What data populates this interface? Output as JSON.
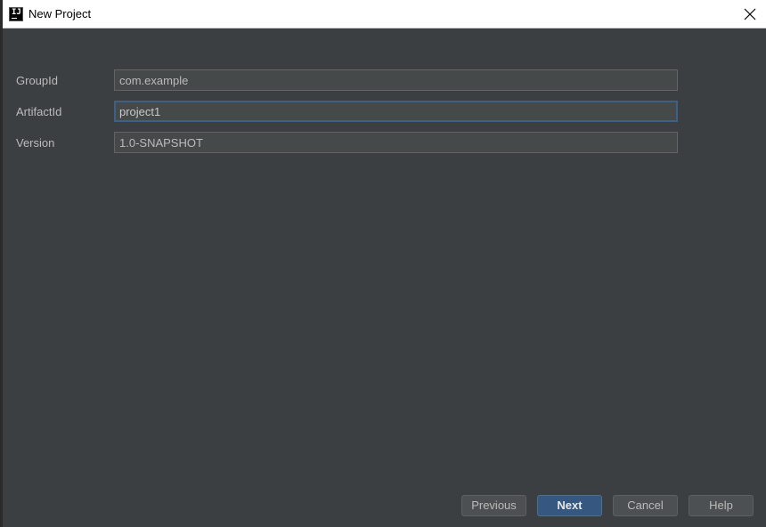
{
  "window": {
    "title": "New Project",
    "app_icon_text": "IJ"
  },
  "form": {
    "fields": [
      {
        "label": "GroupId",
        "value": "com.example"
      },
      {
        "label": "ArtifactId",
        "value": "project1"
      },
      {
        "label": "Version",
        "value": "1.0-SNAPSHOT"
      }
    ]
  },
  "buttons": {
    "previous": "Previous",
    "next": "Next",
    "cancel": "Cancel",
    "help": "Help"
  },
  "colors": {
    "dialog_bg": "#3c3f41",
    "field_bg": "#45494a",
    "focus_border": "#3d6185",
    "primary_button": "#365880"
  },
  "icons": {
    "app": "intellij-idea-icon",
    "close": "close-icon"
  }
}
